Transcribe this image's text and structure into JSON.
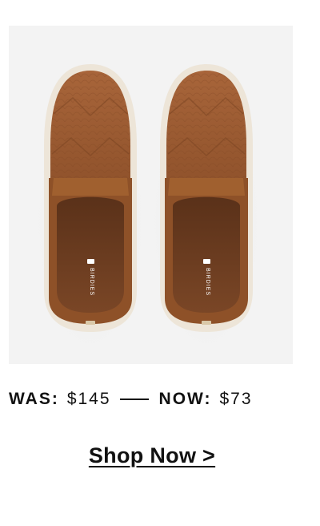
{
  "product": {
    "image_alt": "Brown snake-embossed slip-on sneakers, top view",
    "insole_brand": "BIRDIES",
    "colors": {
      "leather": "#9a5a30",
      "leather_dark": "#7a4321",
      "sole": "#ede5d8",
      "background": "#f3f3f3"
    }
  },
  "pricing": {
    "was_label": "WAS:",
    "was_value": "$145",
    "now_label": "NOW:",
    "now_value": "$73"
  },
  "cta": {
    "label": "Shop Now >"
  }
}
